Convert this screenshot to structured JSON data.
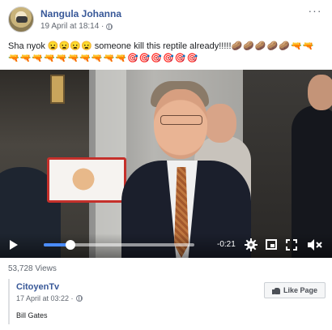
{
  "post": {
    "author": "Nangula Johanna",
    "timestamp": "19 April at 18:14 ·",
    "text": "Sha nyok 😦😦😦😦 someone kill this reptile already!!!!!",
    "emoji_line1": "🥔🥔🥔🥔🥔🔫🔫",
    "emoji_line2": "🔫🔫🔫🔫🔫🔫🔫🔫🔫🔫🎯🎯🎯🎯🎯🎯",
    "more_options": "···"
  },
  "video": {
    "time_remaining": "-0:21",
    "progress_fraction": 0.18,
    "controls": {
      "play": "play-icon",
      "settings": "gear-icon",
      "pip": "picture-in-picture-icon",
      "fullscreen": "fullscreen-icon",
      "mute": "volume-muted-icon"
    },
    "accent_color": "#4a8cff"
  },
  "views": "53,728 Views",
  "shared": {
    "page_name": "CitoyenTv",
    "timestamp": "17 April at 03:22 ·",
    "caption": "Bill Gates",
    "like_page_label": "Like Page"
  }
}
